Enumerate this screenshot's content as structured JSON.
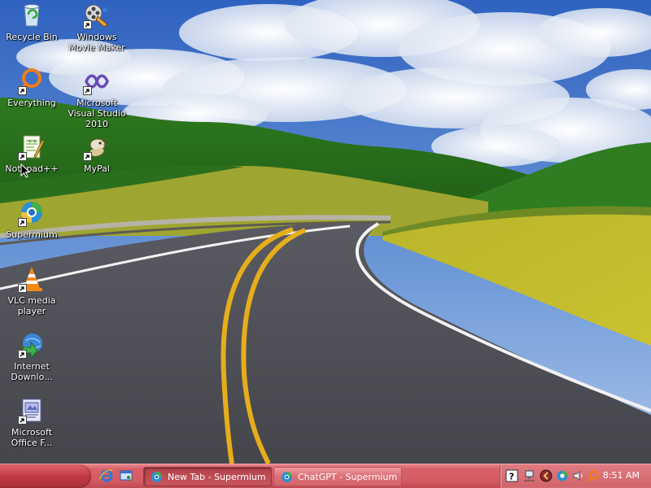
{
  "desktop": {
    "icons": [
      {
        "label": "Recycle Bin",
        "icon": "recycle-bin-icon",
        "shortcut": false
      },
      {
        "label": "Windows Movie Maker",
        "icon": "movie-maker-icon",
        "shortcut": true
      },
      {
        "label": "Everything",
        "icon": "everything-search-icon",
        "shortcut": true
      },
      {
        "label": "Microsoft Visual Studio 2010",
        "icon": "visual-studio-icon",
        "shortcut": true
      },
      {
        "label": "Notepad++",
        "icon": "notepad-plus-plus-icon",
        "shortcut": true
      },
      {
        "label": "MyPal",
        "icon": "mypal-browser-icon",
        "shortcut": true
      },
      {
        "label": "Supermium",
        "icon": "supermium-browser-icon",
        "shortcut": true
      },
      {
        "label": "VLC media player",
        "icon": "vlc-cone-icon",
        "shortcut": true
      },
      {
        "label": "Internet Downlo...",
        "icon": "internet-download-manager-icon",
        "shortcut": true
      },
      {
        "label": "Microsoft Office F...",
        "icon": "office-file-icon",
        "shortcut": true
      }
    ]
  },
  "taskbar": {
    "quick_launch": [
      {
        "icon": "internet-explorer-icon"
      },
      {
        "icon": "show-desktop-icon"
      }
    ],
    "tasks": [
      {
        "label": "New Tab - Supermium",
        "icon": "supermium-browser-icon",
        "active": true
      },
      {
        "label": "ChatGPT - Supermium",
        "icon": "supermium-browser-icon",
        "active": false
      }
    ],
    "tray": {
      "icons": [
        "help-icon",
        "network-icon",
        "mypal-tray-icon",
        "supermium-tray-icon",
        "volume-icon",
        "everything-tray-icon"
      ],
      "clock": "8:51 AM"
    }
  },
  "colors": {
    "taskbar": "#d35b63",
    "sky": "#3a6fc4",
    "grass": "#3f8a2a",
    "road": "#4a4a52",
    "road_line": "#e8b020"
  }
}
